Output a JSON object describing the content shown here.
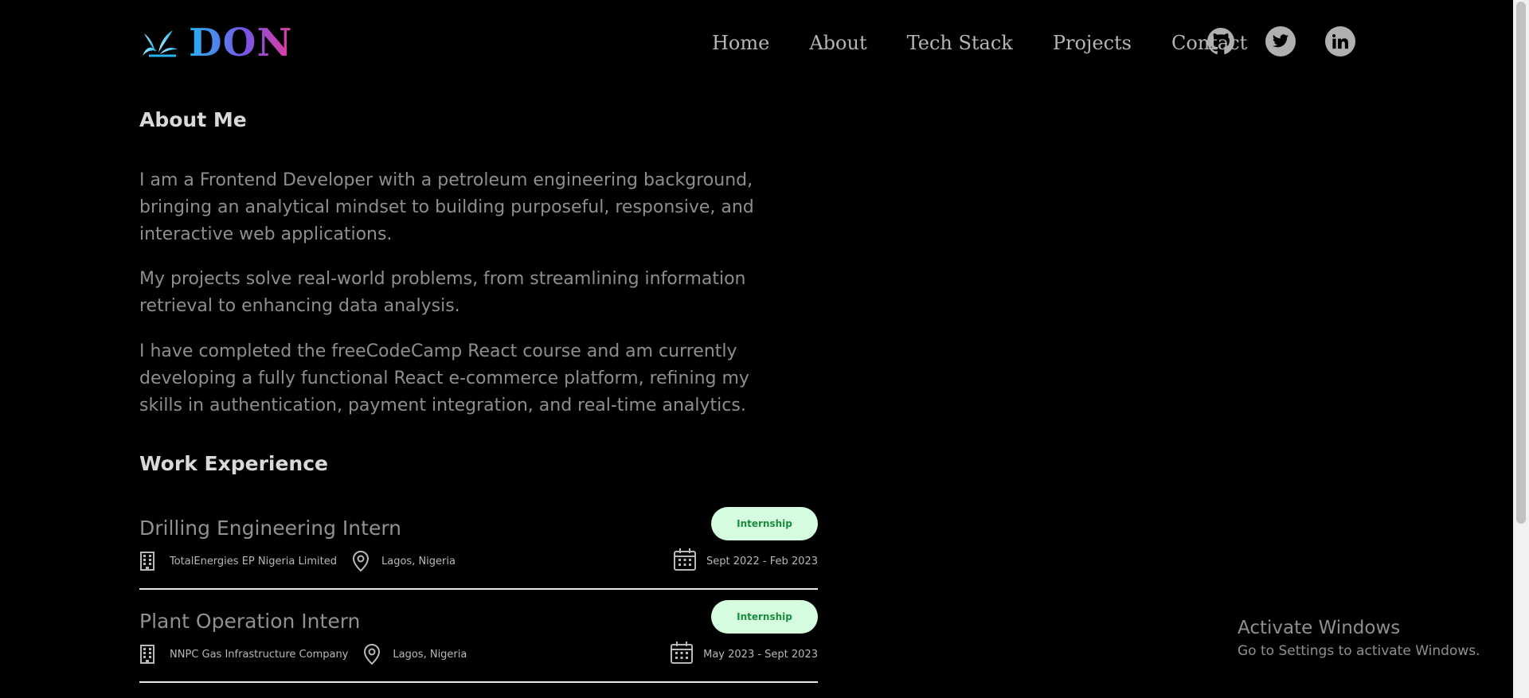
{
  "header": {
    "logo_text": "DON",
    "nav": [
      "Home",
      "About",
      "Tech Stack",
      "Projects",
      "Contact"
    ],
    "socials": [
      "github-icon",
      "twitter-icon",
      "linkedin-icon"
    ]
  },
  "about": {
    "title": "About Me",
    "paragraphs": [
      "I am a Frontend Developer with a petroleum engineering background, bringing an analytical mindset to building purposeful, responsive, and interactive web applications.",
      "My projects solve real-world problems, from streamlining information retrieval to enhancing data analysis.",
      "I have completed the freeCodeCamp React course and am currently developing a fully functional React e-commerce platform, refining my skills in authentication, payment integration, and real-time analytics."
    ]
  },
  "work": {
    "title": "Work Experience",
    "jobs": [
      {
        "title": "Drilling Engineering Intern",
        "badge": "Internship",
        "company": "TotalEnergies EP Nigeria Limited",
        "location": "Lagos, Nigeria",
        "dates": "Sept 2022 - Feb 2023"
      },
      {
        "title": "Plant Operation Intern",
        "badge": "Internship",
        "company": "NNPC Gas Infrastructure Company",
        "location": "Lagos, Nigeria",
        "dates": "May 2023 - Sept 2023"
      }
    ]
  },
  "watermark": {
    "title": "Activate Windows",
    "subtitle": "Go to Settings to activate Windows."
  },
  "colors": {
    "background": "#000000",
    "badge_bg": "#d6fcdf",
    "badge_text": "#1b8b3d",
    "logo_gradient": [
      "#27b3f2",
      "#7a55e6",
      "#e53a9c"
    ]
  }
}
